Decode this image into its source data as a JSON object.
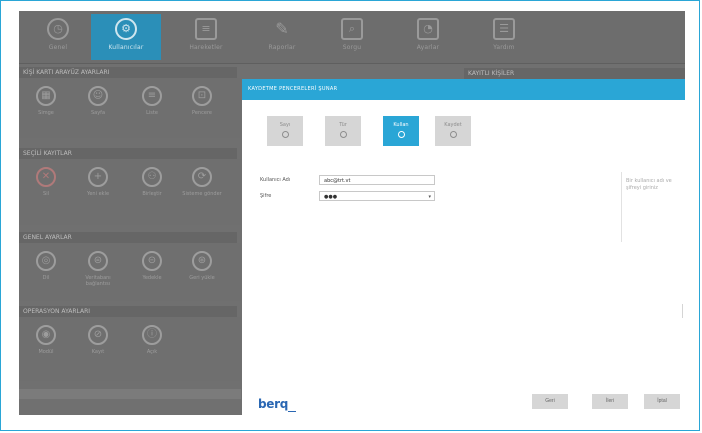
{
  "toolbar": {
    "items": [
      {
        "label": "Genel",
        "icon": "clock-icon"
      },
      {
        "label": "Kullanıcılar",
        "icon": "user-gear-icon"
      },
      {
        "label": "Hareketler",
        "icon": "list-icon"
      },
      {
        "label": "Raporlar",
        "icon": "pencil-icon"
      },
      {
        "label": "Sorgu",
        "icon": "search-icon"
      },
      {
        "label": "Ayarlar",
        "icon": "clock-small-icon"
      },
      {
        "label": "Yardım",
        "icon": "document-icon"
      }
    ],
    "active_index": 1
  },
  "panels": {
    "titles": [
      "KİŞİ KARTI ARAYÜZ AYARLARI",
      "SEÇİLİ KAYITLAR",
      "GENEL AYARLAR",
      "OPERASYON AYARLARI"
    ],
    "right_title": "KAYITLI KİŞİLER",
    "row1": [
      "Simge",
      "Sayfa",
      "Liste",
      "Pencere"
    ],
    "row2": [
      "Sil",
      "Yeni ekle",
      "Birleştir",
      "Sisteme gönder"
    ],
    "row3": [
      "Dil",
      "Veritabanı bağlantısı",
      "Yedekle",
      "Geri yükle"
    ],
    "row4": [
      "Modül",
      "Kayıt",
      "Açık"
    ]
  },
  "dialog": {
    "title": "KAYDETME PENCERELERİ ŞUNAR",
    "modes": [
      {
        "label": "Sayı"
      },
      {
        "label": "Tür"
      },
      {
        "label": "Kullan"
      },
      {
        "label": "Kaydet"
      }
    ],
    "active_mode": 2,
    "fields": {
      "username_label": "Kullanıcı Adı",
      "username_value": "abc@trt.vt",
      "password_label": "Şifre",
      "password_value": "●●●",
      "password_arrow": "▾"
    },
    "helper_text": "Bir kullanıcı adı ve şifreyi giriniz",
    "logo": "berq",
    "buttons": {
      "first": "Geri",
      "second": "İleri",
      "third": "İptal"
    }
  },
  "colors": {
    "accent": "#2aa6d6",
    "overlay": "#707070",
    "brand": "#2a67b3"
  }
}
